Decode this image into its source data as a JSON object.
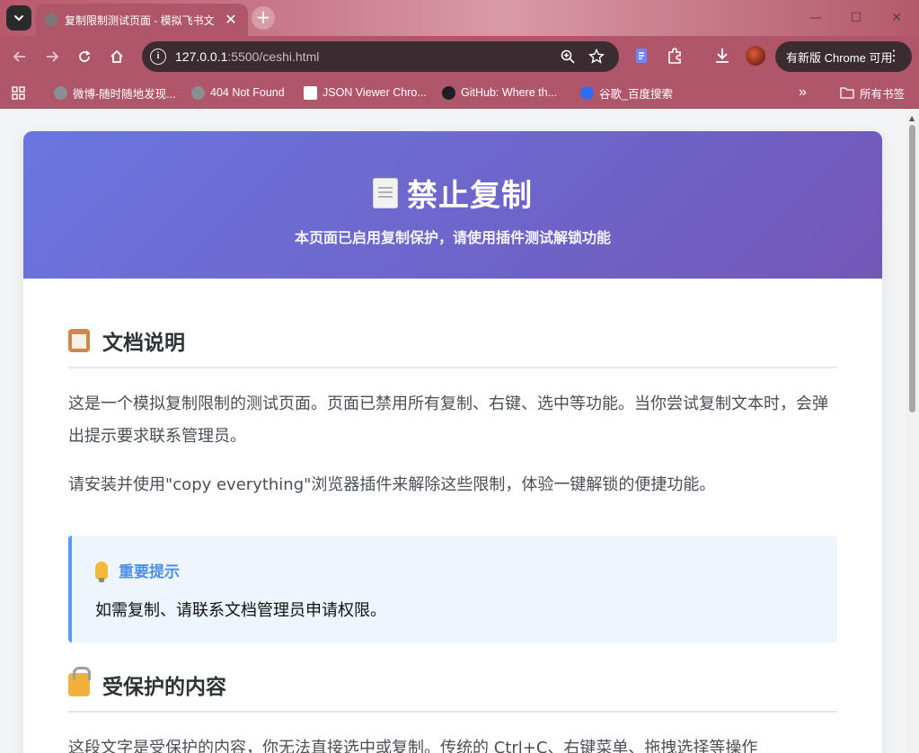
{
  "browser": {
    "tab": {
      "title": "复制限制测试页面 - 模拟飞书文",
      "close": "✕"
    },
    "new_tab": "+",
    "window": {
      "minimize": "—",
      "maximize": "☐",
      "close": "✕"
    },
    "url": {
      "host": "127.0.0.1",
      "rest": ":5500/ceshi.html"
    },
    "update_button": "有新版 Chrome 可用",
    "menu": "⋮",
    "bookmarks": [
      {
        "label": "微博-随时随地发现...",
        "icon": "globe-icon",
        "color": "#8a8f94"
      },
      {
        "label": "404 Not Found",
        "icon": "globe-icon",
        "color": "#8a8f94"
      },
      {
        "label": "JSON Viewer Chro...",
        "icon": "json-viewer-icon",
        "color": "#ffffff"
      },
      {
        "label": "GitHub: Where th...",
        "icon": "github-icon",
        "color": "#1b1f23"
      },
      {
        "label": "谷歌_百度搜索",
        "icon": "baidu-icon",
        "color": "#2f6df2"
      }
    ],
    "bookmarks_more": "»",
    "all_bookmarks": "所有书签"
  },
  "page": {
    "hero": {
      "title": "禁止复制",
      "subtitle": "本页面已启用复制保护，请使用插件测试解锁功能"
    },
    "section1": {
      "heading": "文档说明",
      "para1": "这是一个模拟复制限制的测试页面。页面已禁用所有复制、右键、选中等功能。当你尝试复制文本时，会弹出提示要求联系管理员。",
      "para2": "请安装并使用\"copy everything\"浏览器插件来解除这些限制，体验一键解锁的便捷功能。"
    },
    "tip": {
      "heading": "重要提示",
      "text": "如需复制、请联系文档管理员申请权限。"
    },
    "section2": {
      "heading": "受保护的内容",
      "para1": "这段文字是受保护的内容，你无法直接选中或复制。传统的 Ctrl+C、右键菜单、拖拽选择等操作"
    }
  },
  "colors": {
    "hero_start": "#6a76e0",
    "hero_end": "#7257b8",
    "tip_accent": "#5b9bf0",
    "chrome_accent": "#b0566a"
  }
}
